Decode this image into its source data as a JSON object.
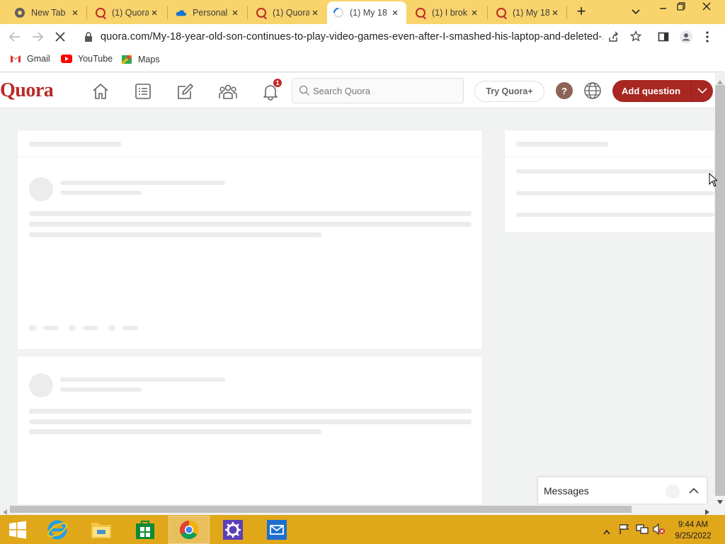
{
  "browser": {
    "tabs": [
      {
        "title": "New Tab",
        "icon": "chrome-icon"
      },
      {
        "title": "(1) Quora",
        "icon": "quora-favicon"
      },
      {
        "title": "Personal",
        "icon": "onedrive-icon"
      },
      {
        "title": "(1) Quora",
        "icon": "quora-favicon"
      },
      {
        "title": "(1) My 18",
        "icon": "loading-favicon",
        "active": true
      },
      {
        "title": "(1) I brok",
        "icon": "quora-favicon"
      },
      {
        "title": "(1) My 18",
        "icon": "quora-favicon"
      }
    ],
    "new_tab": "+",
    "url": "quora.com/My-18-year-old-son-continues-to-play-video-games-even-after-I-smashed-his-laptop-and-deleted-...",
    "bookmarks": [
      {
        "label": "Gmail",
        "icon": "gmail-icon"
      },
      {
        "label": "YouTube",
        "icon": "youtube-icon"
      },
      {
        "label": "Maps",
        "icon": "maps-icon"
      }
    ],
    "window_controls": [
      "minimize-icon",
      "restore-icon",
      "close-icon"
    ]
  },
  "quora": {
    "logo": "Quora",
    "nav_icons": [
      "home-icon",
      "following-icon",
      "answer-icon",
      "spaces-icon",
      "notifications-icon"
    ],
    "notification_count": "1",
    "search_placeholder": "Search Quora",
    "try_plus": "Try Quora+",
    "help": "?",
    "add_question": "Add question",
    "messages_label": "Messages",
    "colors": {
      "brand": "#b92b27",
      "add_button": "#a82723"
    }
  },
  "taskbar": {
    "apps": [
      "internet-explorer-icon",
      "file-explorer-icon",
      "store-icon",
      "chrome-icon",
      "control-panel-icon",
      "mail-icon"
    ],
    "time": "9:44 AM",
    "date": "9/25/2022"
  }
}
